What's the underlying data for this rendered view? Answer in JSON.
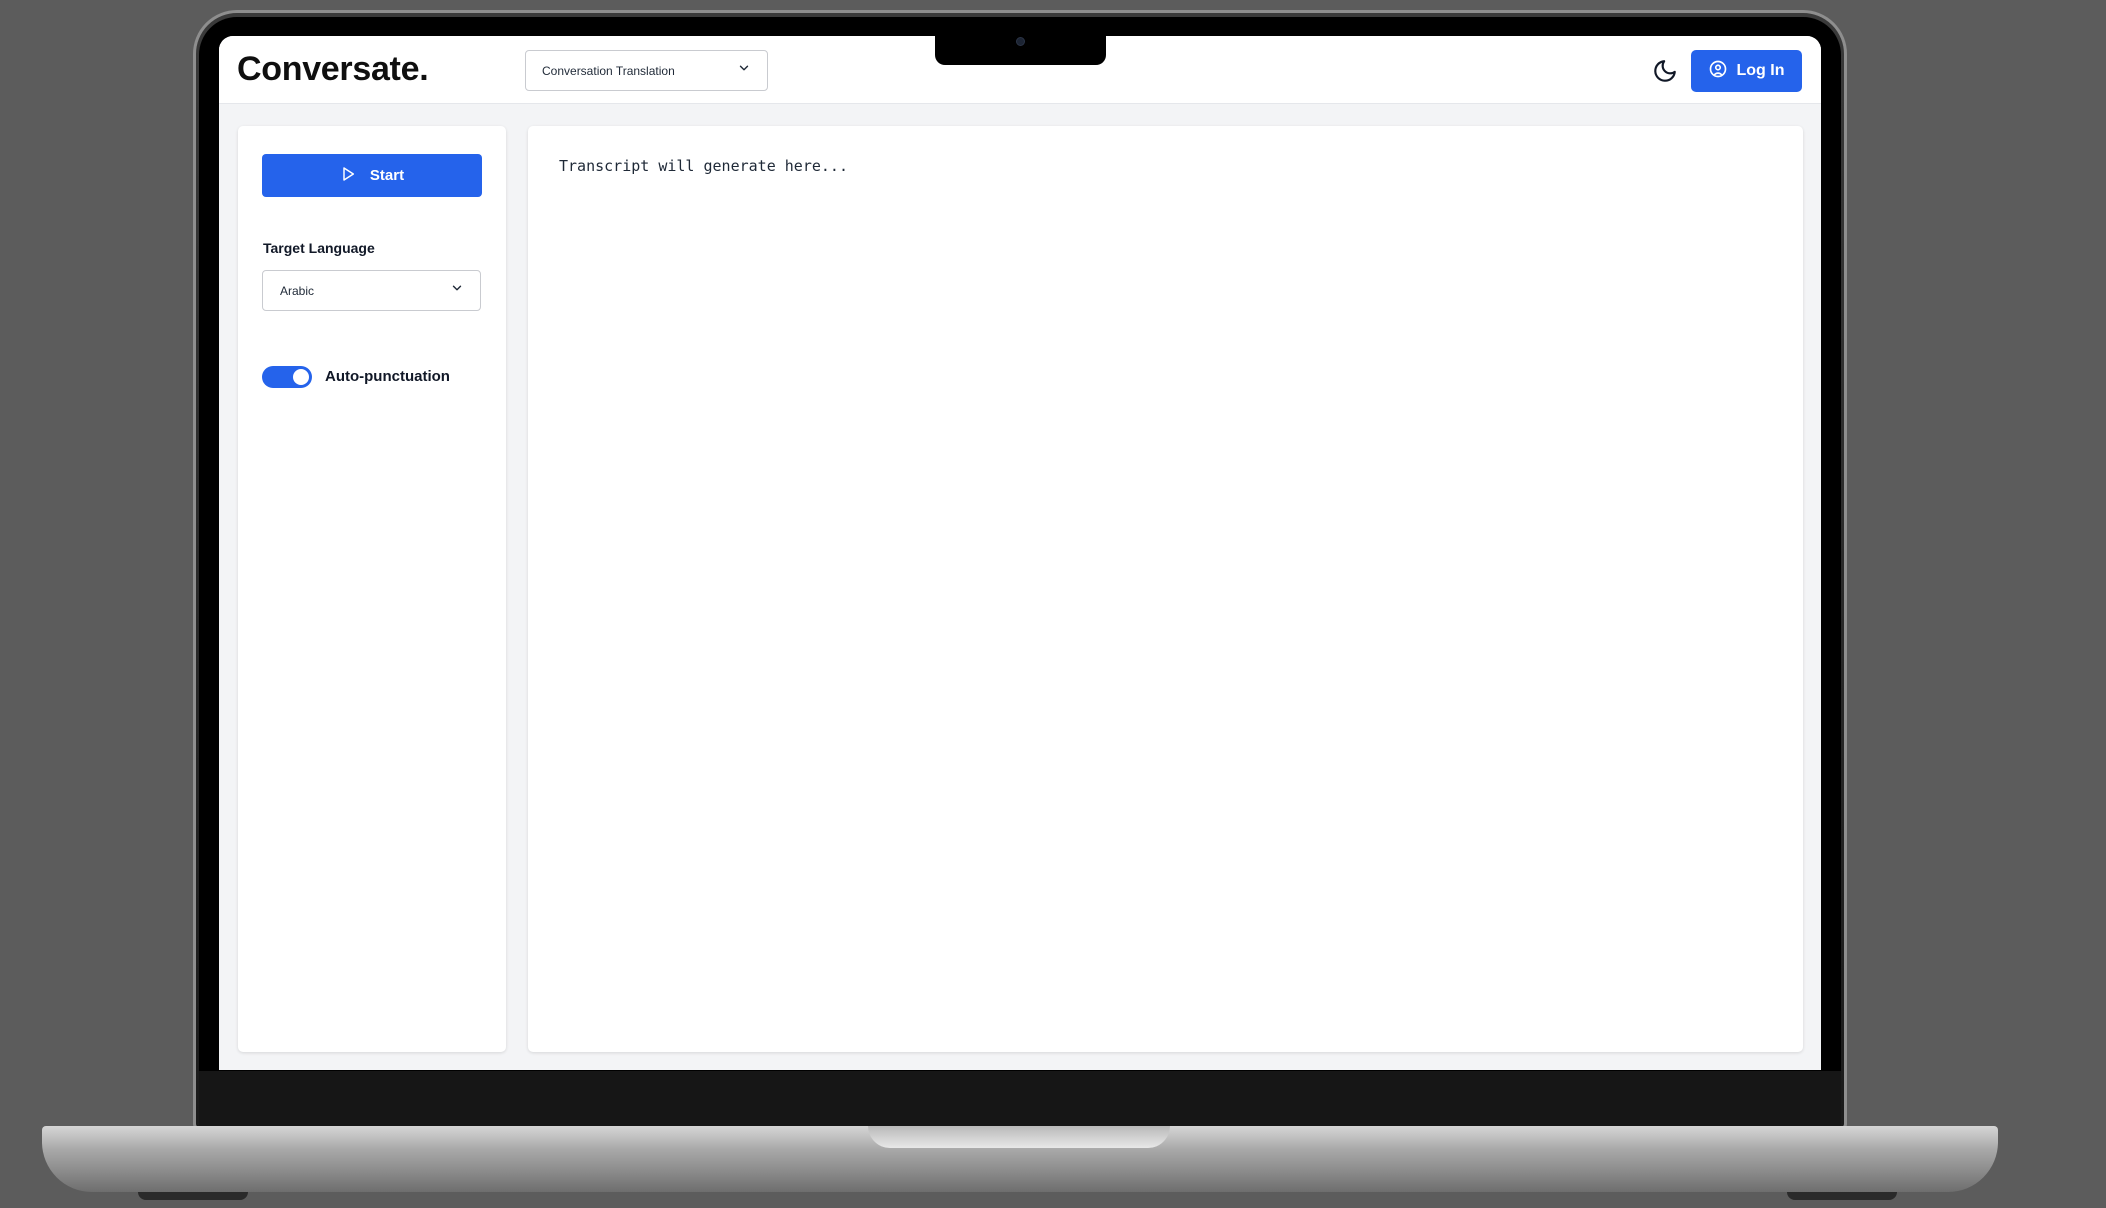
{
  "app": {
    "logo": "Conversate."
  },
  "header": {
    "mode_select": {
      "value": "Conversation Translation"
    },
    "login_label": "Log In"
  },
  "sidebar": {
    "start_label": "Start",
    "target_language_label": "Target Language",
    "target_language_value": "Arabic",
    "auto_punctuation_label": "Auto-punctuation",
    "auto_punctuation_on": true
  },
  "transcript": {
    "placeholder": "Transcript will generate here..."
  },
  "colors": {
    "accent": "#2563eb",
    "panel_bg": "#ffffff",
    "page_bg": "#f3f4f6"
  },
  "icons": {
    "mode_chevron": "chevron-down-icon",
    "theme": "moon-icon",
    "user": "user-circle-icon",
    "start": "play-icon",
    "lang_chevron": "chevron-down-icon"
  }
}
